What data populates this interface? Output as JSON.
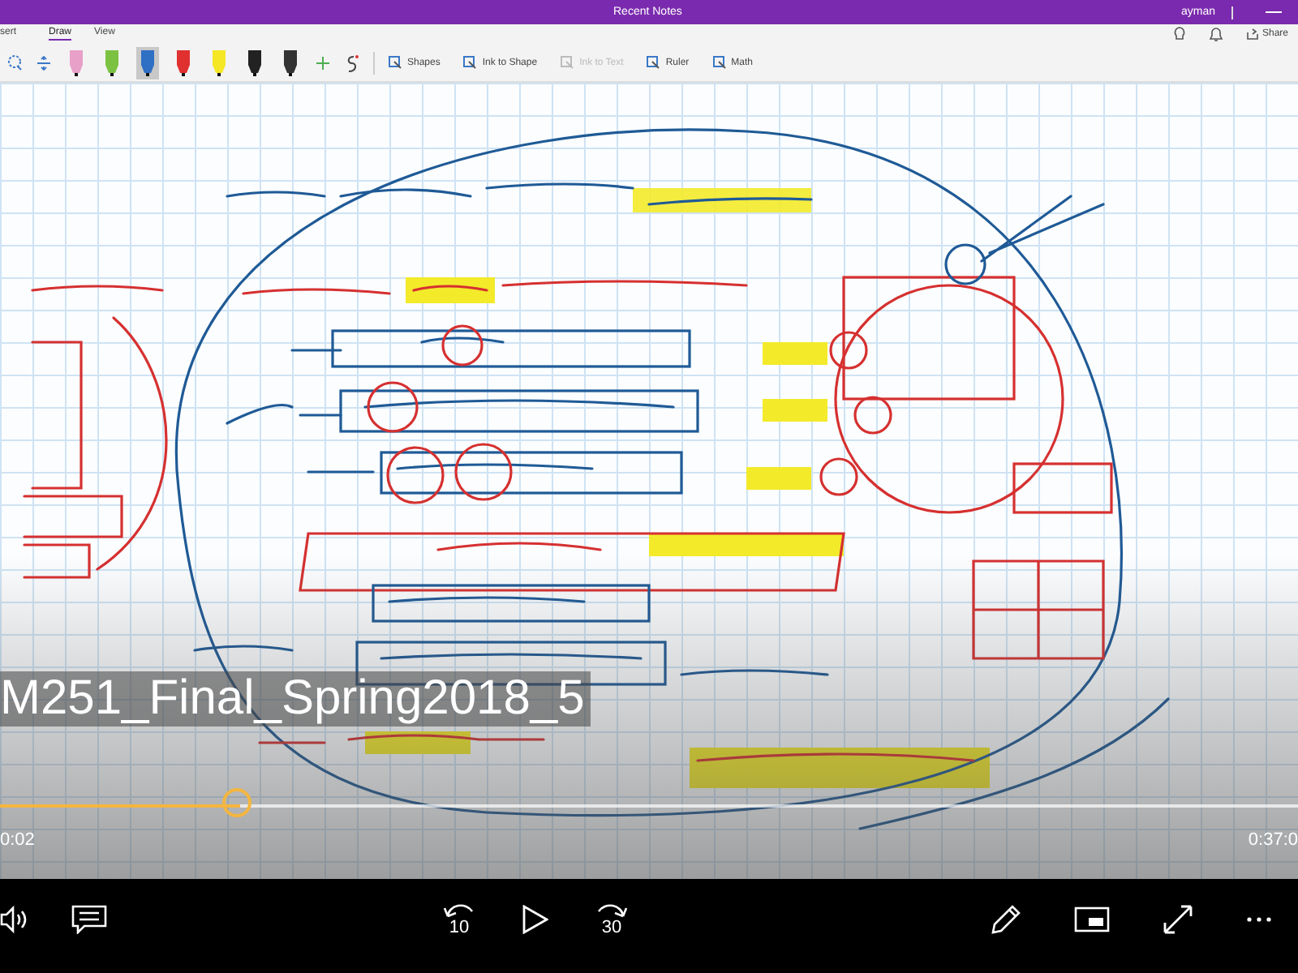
{
  "window": {
    "title": "Recent Notes",
    "user": "ayman"
  },
  "ribbon_tabs": [
    {
      "label": "sert",
      "selected": false
    },
    {
      "label": "Draw",
      "selected": true
    },
    {
      "label": "View",
      "selected": false
    }
  ],
  "share_label": "Share",
  "pens": [
    {
      "color": "#e8a0c8",
      "selected": false
    },
    {
      "color": "#7cc242",
      "selected": false
    },
    {
      "color": "#2f6fc4",
      "selected": true
    },
    {
      "color": "#e03030",
      "selected": false
    },
    {
      "color": "#f5e626",
      "selected": false
    },
    {
      "color": "#222222",
      "selected": false
    },
    {
      "color": "#333333",
      "selected": false
    }
  ],
  "tools": [
    {
      "label": "Shapes",
      "disabled": false
    },
    {
      "label": "Ink to Shape",
      "disabled": false
    },
    {
      "label": "Ink to Text",
      "disabled": true
    },
    {
      "label": "Ruler",
      "disabled": false
    },
    {
      "label": "Math",
      "disabled": false
    }
  ],
  "video": {
    "title": "M251_Final_Spring2018_5",
    "elapsed": "0:02",
    "duration": "0:37:0",
    "level": 0.185,
    "skip_back": "10",
    "skip_forward": "30"
  }
}
